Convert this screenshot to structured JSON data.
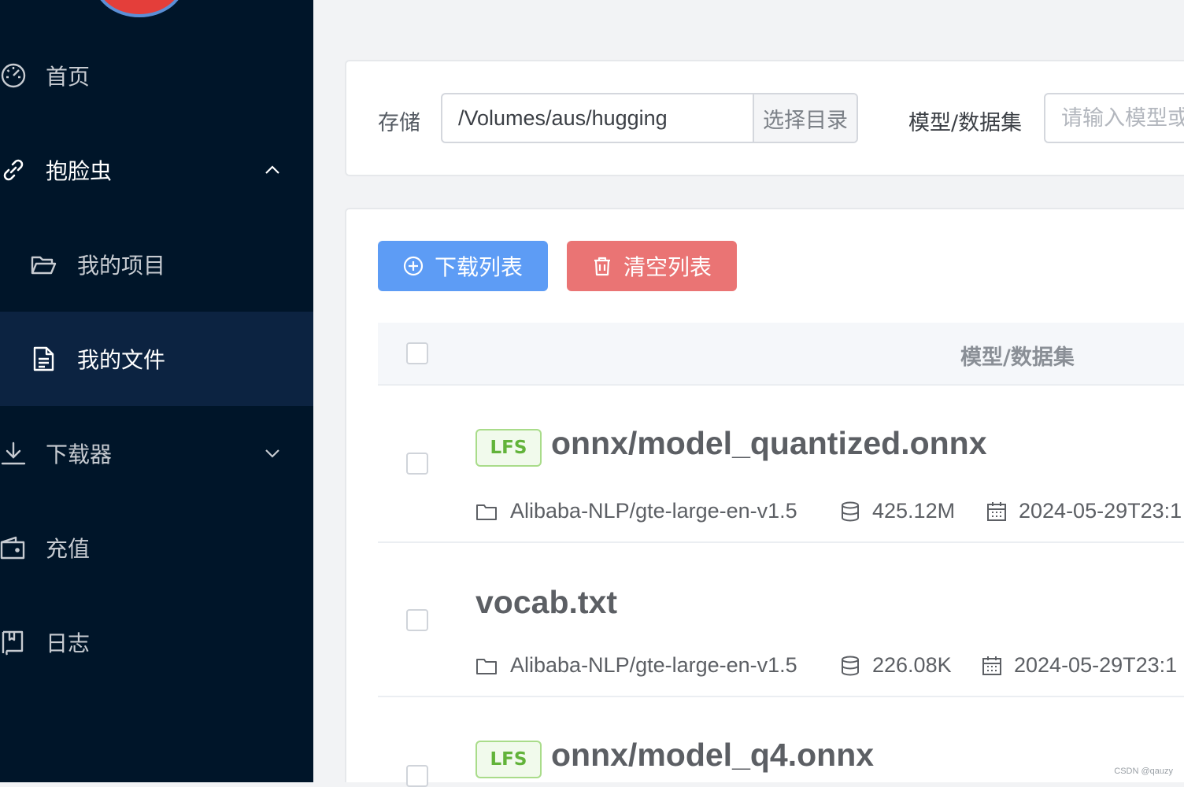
{
  "sidebar": {
    "items": [
      {
        "label": "首页",
        "icon": "dashboard-icon"
      },
      {
        "label": "抱脸虫",
        "icon": "link-icon",
        "expanded": true
      },
      {
        "label": "我的项目",
        "icon": "folder-open-icon"
      },
      {
        "label": "我的文件",
        "icon": "document-icon",
        "active": true
      },
      {
        "label": "下载器",
        "icon": "download-icon",
        "expanded": false
      },
      {
        "label": "充值",
        "icon": "wallet-icon"
      },
      {
        "label": "日志",
        "icon": "notebook-icon"
      }
    ]
  },
  "toolbar": {
    "storage_label": "存储",
    "storage_value": "/Volumes/aus/hugging",
    "choose_dir_label": "选择目录",
    "model_label": "模型/数据集",
    "model_placeholder": "请输入模型或"
  },
  "actions": {
    "download_list_label": "下载列表",
    "clear_list_label": "清空列表"
  },
  "table": {
    "header": "模型/数据集",
    "rows": [
      {
        "lfs": "LFS",
        "name": "onnx/model_quantized.onnx",
        "repo": "Alibaba-NLP/gte-large-en-v1.5",
        "size": "425.12M",
        "date": "2024-05-29T23:1"
      },
      {
        "lfs": "",
        "name": "vocab.txt",
        "repo": "Alibaba-NLP/gte-large-en-v1.5",
        "size": "226.08K",
        "date": "2024-05-29T23:1"
      },
      {
        "lfs": "LFS",
        "name": "onnx/model_q4.onnx",
        "repo": "",
        "size": "",
        "date": ""
      }
    ]
  },
  "watermark": "CSDN @qauzy",
  "colors": {
    "sidebar_bg": "#001529",
    "primary": "#5d9cf5",
    "danger": "#ea7474",
    "lfs_green": "#62b33a"
  }
}
